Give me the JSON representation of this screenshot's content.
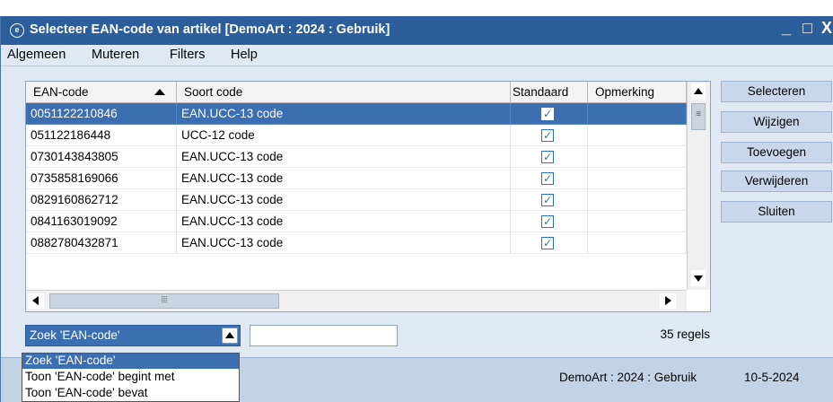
{
  "window": {
    "title": "Selecteer EAN-code van artikel  [DemoArt : 2024 : Gebruik]",
    "minimize": "_",
    "maximize": "□",
    "close": "X"
  },
  "menu": [
    "Algemeen",
    "Muteren",
    "Filters",
    "Help"
  ],
  "grid": {
    "columns": [
      "EAN-code",
      "Soort code",
      "Standaard",
      "Opmerking"
    ],
    "rows": [
      {
        "ean": "0051122210846",
        "soort": "EAN.UCC-13 code",
        "standaard": true,
        "opmerking": "",
        "selected": true
      },
      {
        "ean": "051122186448",
        "soort": "UCC-12 code",
        "standaard": true,
        "opmerking": "",
        "selected": false
      },
      {
        "ean": "0730143843805",
        "soort": "EAN.UCC-13 code",
        "standaard": true,
        "opmerking": "",
        "selected": false
      },
      {
        "ean": "0735858169066",
        "soort": "EAN.UCC-13 code",
        "standaard": true,
        "opmerking": "",
        "selected": false
      },
      {
        "ean": "0829160862712",
        "soort": "EAN.UCC-13 code",
        "standaard": true,
        "opmerking": "",
        "selected": false
      },
      {
        "ean": "0841163019092",
        "soort": "EAN.UCC-13 code",
        "standaard": true,
        "opmerking": "",
        "selected": false
      },
      {
        "ean": "0882780432871",
        "soort": "EAN.UCC-13 code",
        "standaard": true,
        "opmerking": "",
        "selected": false
      }
    ],
    "check_glyph": "✓",
    "scroll_thumb_glyph": "≡",
    "hscroll_thumb_glyph": "⦙⦙⦙"
  },
  "buttons": {
    "selecteren": "Selecteren",
    "wijzigen": "Wijzigen",
    "toevoegen": "Toevoegen",
    "verwijderen": "Verwijderen",
    "sluiten": "Sluiten"
  },
  "search": {
    "selected": "Zoek 'EAN-code'",
    "input_value": "",
    "options": [
      "Zoek 'EAN-code'",
      "Toon 'EAN-code' begint met",
      "Toon 'EAN-code' bevat"
    ]
  },
  "row_count": "35 regels",
  "status": {
    "context": "DemoArt : 2024 : Gebruik",
    "date": "10-5-2024"
  },
  "colors": {
    "titlebar": "#2c5e9c",
    "selection": "#3c6fb1",
    "background": "#dfe8f3",
    "button": "#c8d7ea"
  }
}
